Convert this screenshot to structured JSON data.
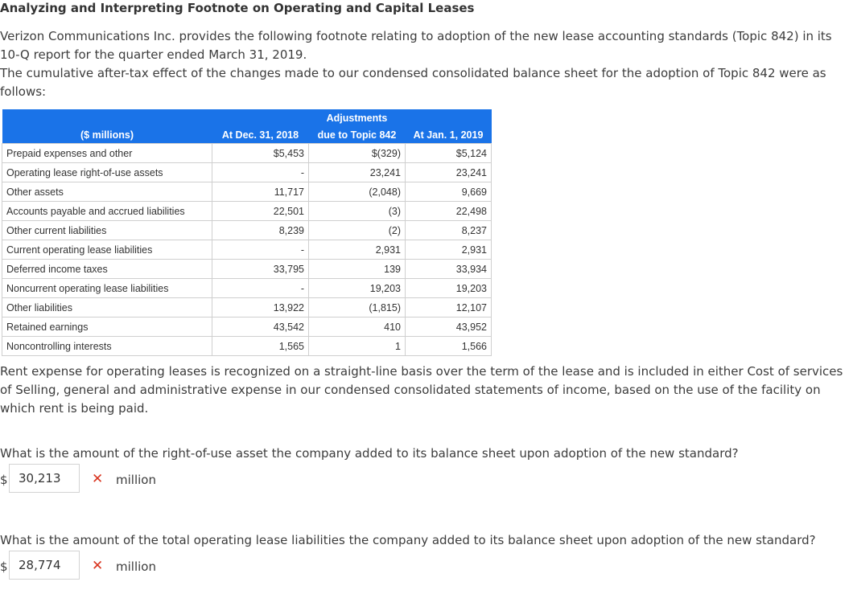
{
  "title": "Analyzing and Interpreting Footnote on Operating and Capital Leases",
  "intro_1": "Verizon Communications Inc. provides the following footnote relating to adoption of the new lease accounting standards (Topic 842) in its 10-Q report for the quarter ended March 31, 2019.",
  "intro_2": "The cumulative after-tax effect of the changes made to our condensed consolidated balance sheet for the adoption of Topic 842 were as follows:",
  "table": {
    "header_top": "Adjustments",
    "headers": [
      "($ millions)",
      "At Dec. 31, 2018",
      "due to Topic 842",
      "At Jan. 1, 2019"
    ],
    "rows": [
      [
        "Prepaid expenses and other",
        "$5,453",
        "$(329)",
        "$5,124"
      ],
      [
        "Operating lease right-of-use assets",
        "-",
        "23,241",
        "23,241"
      ],
      [
        "Other assets",
        "11,717",
        "(2,048)",
        "9,669"
      ],
      [
        "Accounts payable and accrued liabilities",
        "22,501",
        "(3)",
        "22,498"
      ],
      [
        "Other current liabilities",
        "8,239",
        "(2)",
        "8,237"
      ],
      [
        "Current operating lease liabilities",
        "-",
        "2,931",
        "2,931"
      ],
      [
        "Deferred income taxes",
        "33,795",
        "139",
        "33,934"
      ],
      [
        "Noncurrent operating lease liabilities",
        "-",
        "19,203",
        "19,203"
      ],
      [
        "Other liabilities",
        "13,922",
        "(1,815)",
        "12,107"
      ],
      [
        "Retained earnings",
        "43,542",
        "410",
        "43,952"
      ],
      [
        "Noncontrolling interests",
        "1,565",
        "1",
        "1,566"
      ]
    ]
  },
  "rent_paragraph": "Rent expense for operating leases is recognized on a straight-line basis over the term of the lease and is included in either Cost of services of Selling, general and administrative expense in our condensed consolidated statements of income, based on the use of the facility on which rent is being paid.",
  "questions": [
    {
      "text": "What is the amount of the right-of-use asset the company added to its balance sheet upon adoption of the new standard?",
      "currency": "$",
      "value": "30,213",
      "status_icon": "incorrect-x-icon",
      "unit": "million"
    },
    {
      "text": "What is the amount of the total operating lease liabilities the company added to its balance sheet upon adoption of the new standard?",
      "currency": "$",
      "value": "28,774",
      "status_icon": "incorrect-x-icon",
      "unit": "million"
    }
  ],
  "colors": {
    "header_bg": "#1a73e8",
    "incorrect": "#d9341f"
  }
}
